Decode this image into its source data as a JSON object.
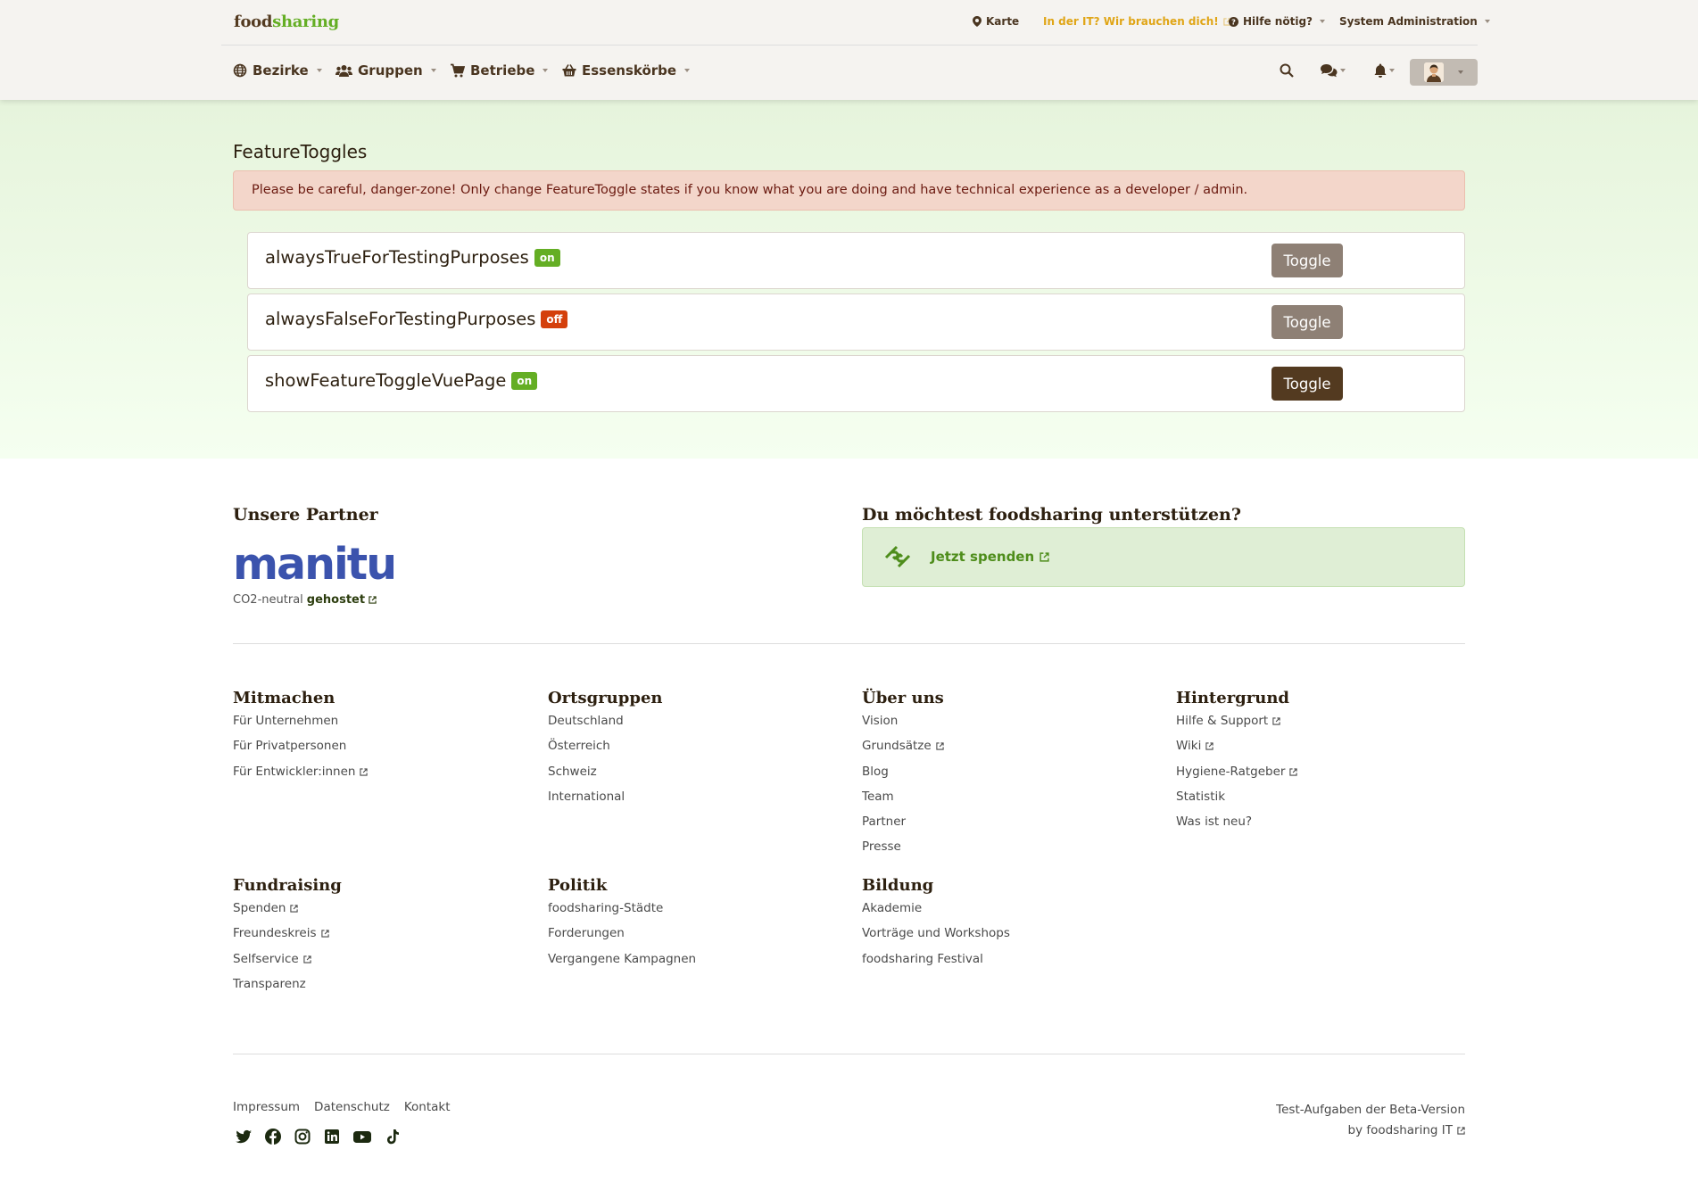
{
  "header": {
    "logo_food": "food",
    "logo_sharing": "sharing",
    "top_links": {
      "map": "Karte",
      "it_call": "In der IT? Wir brauchen dich!",
      "help": "Hilfe nötig?",
      "admin": "System Administration"
    },
    "nav": {
      "districts": "Bezirke",
      "groups": "Gruppen",
      "stores": "Betriebe",
      "baskets": "Essenskörbe"
    }
  },
  "main": {
    "title": "FeatureToggles",
    "warning": "Please be careful, danger-zone! Only change FeatureToggle states if you know what you are doing and have technical experience as a developer / admin.",
    "toggles": [
      {
        "name": "alwaysTrueForTestingPurposes",
        "state": "on",
        "button": "Toggle"
      },
      {
        "name": "alwaysFalseForTestingPurposes",
        "state": "off",
        "button": "Toggle"
      },
      {
        "name": "showFeatureToggleVuePage",
        "state": "on",
        "button": "Toggle"
      }
    ]
  },
  "footer": {
    "partners_heading": "Unsere Partner",
    "partner_logo": "manitu",
    "hosted_prefix": "CO2-neutral",
    "hosted_link": "gehostet",
    "support_heading": "Du möchtest foodsharing unterstützen?",
    "donate_label": "Jetzt spenden",
    "columns": [
      {
        "heading": "Mitmachen",
        "links": [
          "Für Unternehmen",
          "Für Privatpersonen",
          "Für Entwickler:innen"
        ]
      },
      {
        "heading": "Ortsgruppen",
        "links": [
          "Deutschland",
          "Österreich",
          "Schweiz",
          "International"
        ]
      },
      {
        "heading": "Über uns",
        "links": [
          "Vision",
          "Grundsätze",
          "Blog",
          "Team",
          "Partner",
          "Presse"
        ]
      },
      {
        "heading": "Hintergrund",
        "links": [
          "Hilfe & Support",
          "Wiki",
          "Hygiene-Ratgeber",
          "Statistik",
          "Was ist neu?"
        ]
      },
      {
        "heading": "Fundraising",
        "links": [
          "Spenden",
          "Freundeskreis",
          "Selfservice",
          "Transparenz"
        ]
      },
      {
        "heading": "Politik",
        "links": [
          "foodsharing-Städte",
          "Forderungen",
          "Vergangene Kampagnen"
        ]
      },
      {
        "heading": "Bildung",
        "links": [
          "Akademie",
          "Vorträge und Workshops",
          "foodsharing Festival"
        ]
      }
    ],
    "bottom_links": [
      "Impressum",
      "Datenschutz",
      "Kontakt"
    ],
    "beta_line1": "Test-Aufgaben der Beta-Version",
    "beta_line2": "by foodsharing IT"
  },
  "colors": {
    "brand_brown": "#533a20",
    "brand_green": "#64ae24",
    "danger_badge": "#d4400c",
    "alert_bg": "#f3d6ca"
  }
}
